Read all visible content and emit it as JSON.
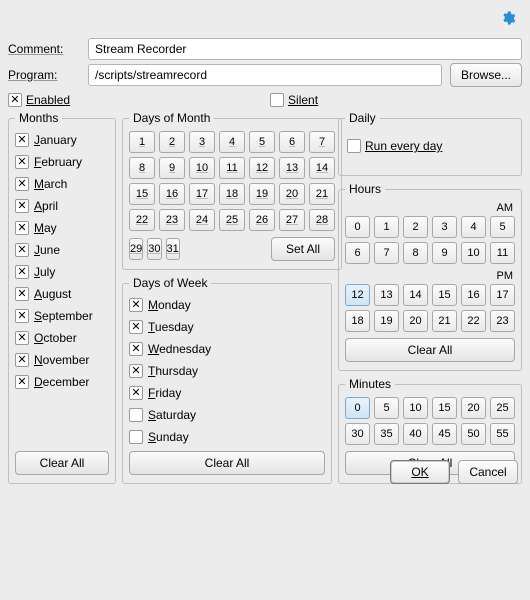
{
  "gearIcon": "gear",
  "labels": {
    "comment": "Comment:",
    "program": "Program:",
    "browse": "Browse...",
    "enabled": "Enabled",
    "silent": "Silent",
    "months": "Months",
    "daysOfMonth": "Days of Month",
    "daysOfWeek": "Days of Week",
    "daily": "Daily",
    "runEveryDay": "Run every day",
    "hours": "Hours",
    "am": "AM",
    "pm": "PM",
    "minutes": "Minutes",
    "setAll": "Set All",
    "clearAll": "Clear All",
    "ok": "OK",
    "cancel": "Cancel"
  },
  "values": {
    "comment": "Stream Recorder",
    "program": "/scripts/streamrecord",
    "enabled": true,
    "silent": false,
    "runEveryDay": false
  },
  "months": [
    {
      "label": "January",
      "checked": true
    },
    {
      "label": "February",
      "checked": true
    },
    {
      "label": "March",
      "checked": true
    },
    {
      "label": "April",
      "checked": true
    },
    {
      "label": "May",
      "checked": true
    },
    {
      "label": "June",
      "checked": true
    },
    {
      "label": "July",
      "checked": true
    },
    {
      "label": "August",
      "checked": true
    },
    {
      "label": "September",
      "checked": true
    },
    {
      "label": "October",
      "checked": true
    },
    {
      "label": "November",
      "checked": true
    },
    {
      "label": "December",
      "checked": true
    }
  ],
  "daysOfMonth": {
    "days": [
      1,
      2,
      3,
      4,
      5,
      6,
      7,
      8,
      9,
      10,
      11,
      12,
      13,
      14,
      15,
      16,
      17,
      18,
      19,
      20,
      21,
      22,
      23,
      24,
      25,
      26,
      27,
      28,
      29,
      30,
      31
    ],
    "selected": []
  },
  "daysOfWeek": [
    {
      "label": "Monday",
      "checked": true
    },
    {
      "label": "Tuesday",
      "checked": true
    },
    {
      "label": "Wednesday",
      "checked": true
    },
    {
      "label": "Thursday",
      "checked": true
    },
    {
      "label": "Friday",
      "checked": true
    },
    {
      "label": "Saturday",
      "checked": false
    },
    {
      "label": "Sunday",
      "checked": false
    }
  ],
  "hours": {
    "am": [
      0,
      1,
      2,
      3,
      4,
      5,
      6,
      7,
      8,
      9,
      10,
      11
    ],
    "pm": [
      12,
      13,
      14,
      15,
      16,
      17,
      18,
      19,
      20,
      21,
      22,
      23
    ],
    "selected": [
      12
    ]
  },
  "minutes": {
    "values": [
      0,
      5,
      10,
      15,
      20,
      25,
      30,
      35,
      40,
      45,
      50,
      55
    ],
    "selected": [
      0
    ]
  }
}
